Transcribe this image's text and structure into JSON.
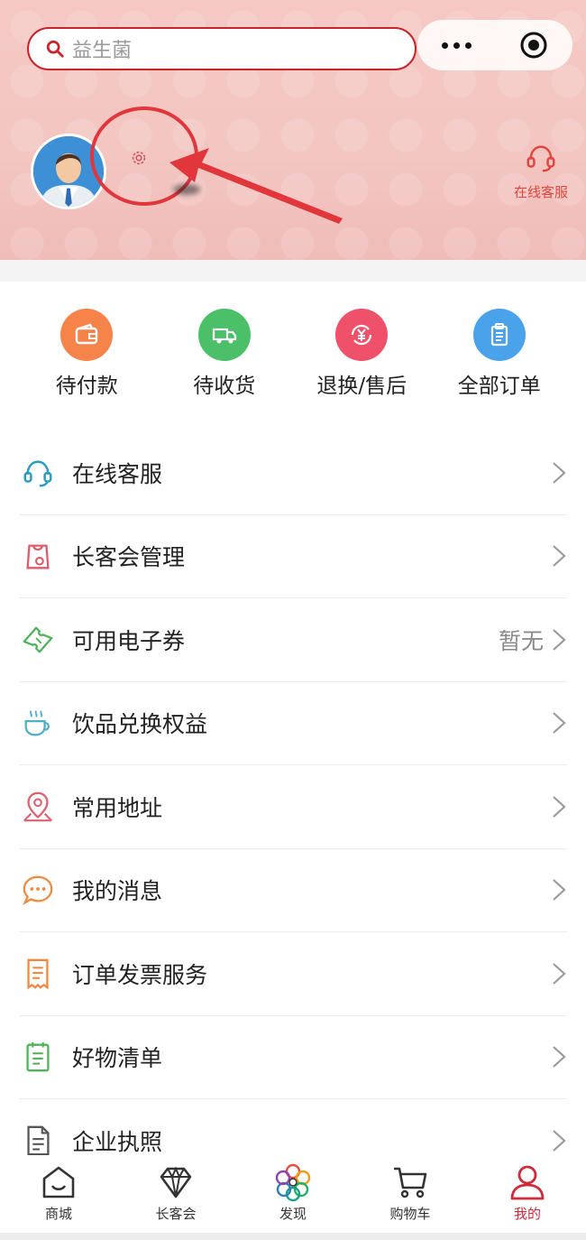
{
  "search": {
    "placeholder": "益生菌"
  },
  "header": {
    "service_label": "在线客服"
  },
  "orders": [
    {
      "label": "待付款",
      "icon": "wallet-icon",
      "color": "#f5834a"
    },
    {
      "label": "待收货",
      "icon": "truck-icon",
      "color": "#4cbf69"
    },
    {
      "label": "退换/售后",
      "icon": "yen-refund-icon",
      "color": "#f0516a"
    },
    {
      "label": "全部订单",
      "icon": "clipboard-icon",
      "color": "#4aa3ea"
    }
  ],
  "menu": [
    {
      "label": "在线客服",
      "value": "",
      "icon": "headset-icon",
      "color": "#2a9bc2"
    },
    {
      "label": "长客会管理",
      "value": "",
      "icon": "member-bag-icon",
      "color": "#e05a6a"
    },
    {
      "label": "可用电子券",
      "value": "暂无",
      "icon": "ticket-icon",
      "color": "#4fb35a"
    },
    {
      "label": "饮品兑换权益",
      "value": "",
      "icon": "coffee-cup-icon",
      "color": "#4fb0c6"
    },
    {
      "label": "常用地址",
      "value": "",
      "icon": "location-pin-icon",
      "color": "#e06070"
    },
    {
      "label": "我的消息",
      "value": "",
      "icon": "chat-bubble-icon",
      "color": "#f08a40"
    },
    {
      "label": "订单发票服务",
      "value": "",
      "icon": "receipt-icon",
      "color": "#f08a40"
    },
    {
      "label": "好物清单",
      "value": "",
      "icon": "checklist-icon",
      "color": "#4fb35a"
    },
    {
      "label": "企业执照",
      "value": "",
      "icon": "document-icon",
      "color": "#555555"
    }
  ],
  "tabs": [
    {
      "label": "商城",
      "icon": "home-icon",
      "active": false
    },
    {
      "label": "长客会",
      "icon": "diamond-icon",
      "active": false
    },
    {
      "label": "发现",
      "icon": "discover-flower-icon",
      "active": false
    },
    {
      "label": "购物车",
      "icon": "cart-icon",
      "active": false
    },
    {
      "label": "我的",
      "icon": "user-icon",
      "active": true
    }
  ],
  "colors": {
    "accent": "#c8242b",
    "active_tab": "#d0293a"
  }
}
